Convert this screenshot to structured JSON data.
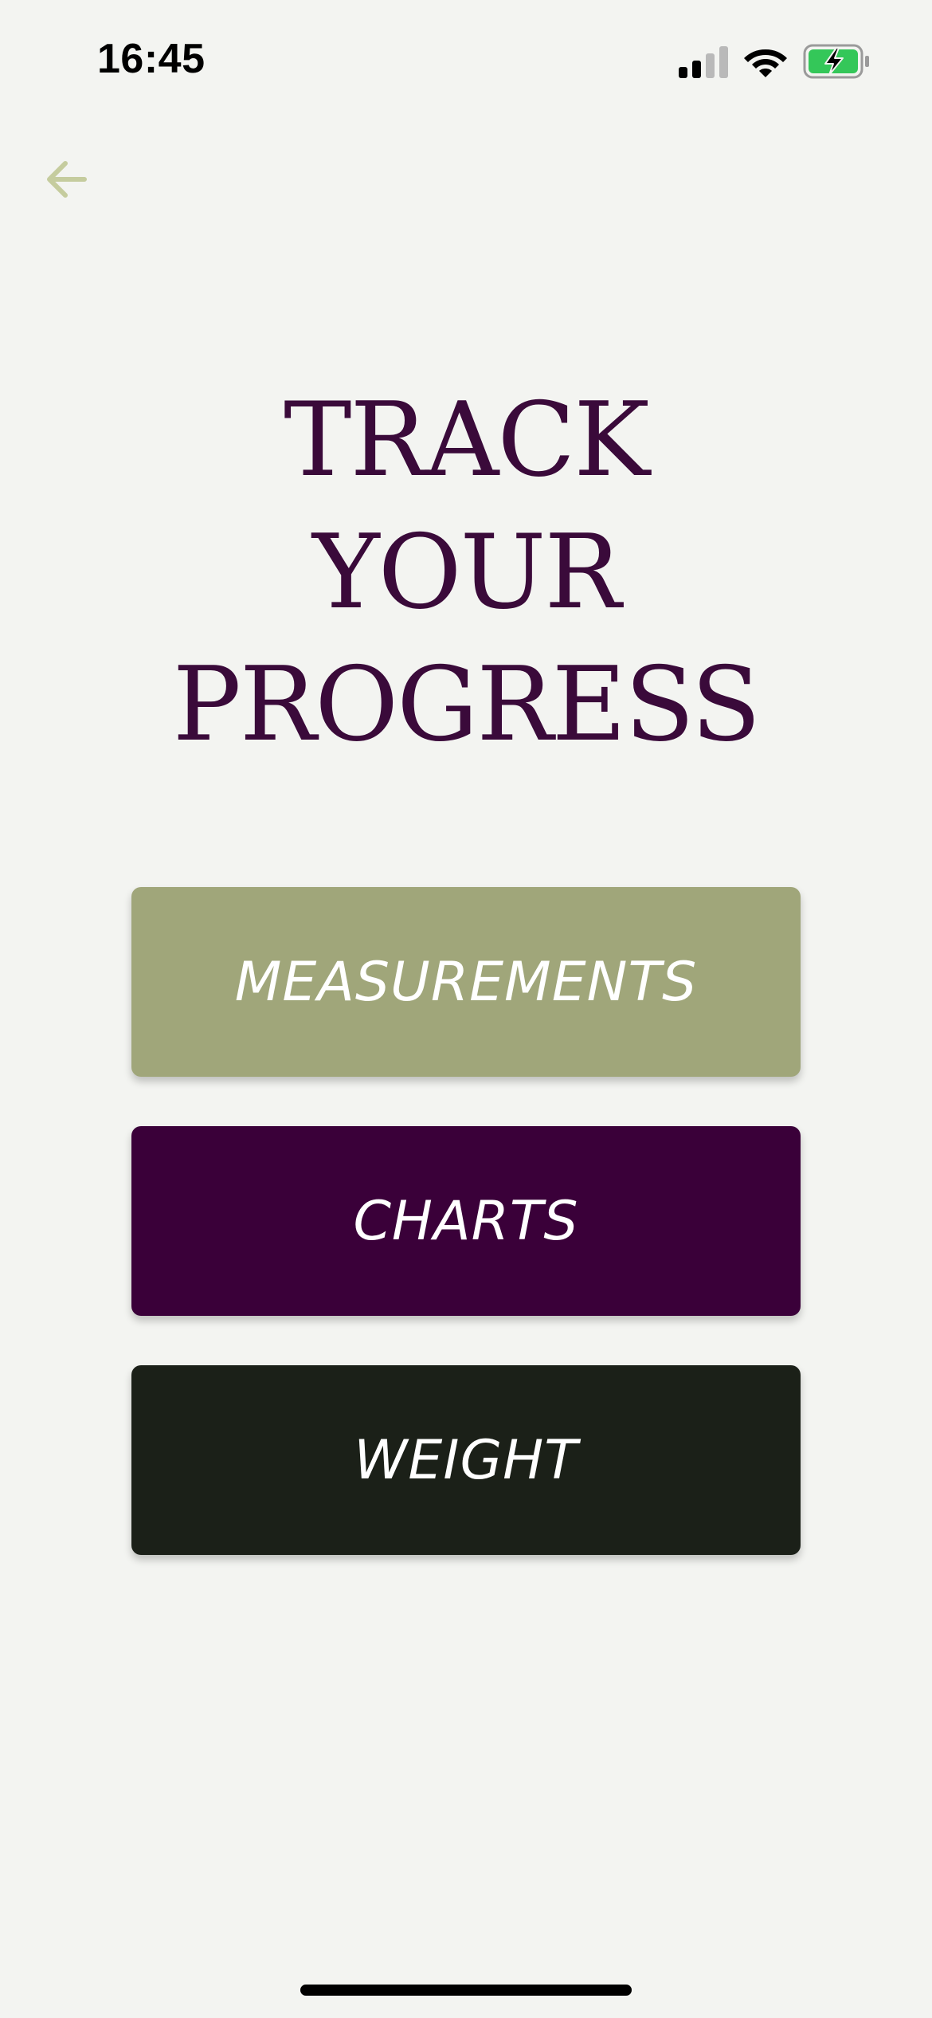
{
  "status_bar": {
    "time": "16:45",
    "signal_icon": "cellular-signal-icon",
    "wifi_icon": "wifi-icon",
    "battery_icon": "battery-charging-icon",
    "battery_color": "#34c759"
  },
  "header": {
    "back_icon": "arrow-left-icon",
    "back_color": "#c5cc9e"
  },
  "title": {
    "line1": "TRACK",
    "line2": "YOUR",
    "line3": "PROGRESS",
    "color": "#3a0a3a"
  },
  "buttons": [
    {
      "label": "MEASUREMENTS",
      "color": "#a0a67a"
    },
    {
      "label": "CHARTS",
      "color": "#3a0039"
    },
    {
      "label": "WEIGHT",
      "color": "#1b2018"
    }
  ]
}
